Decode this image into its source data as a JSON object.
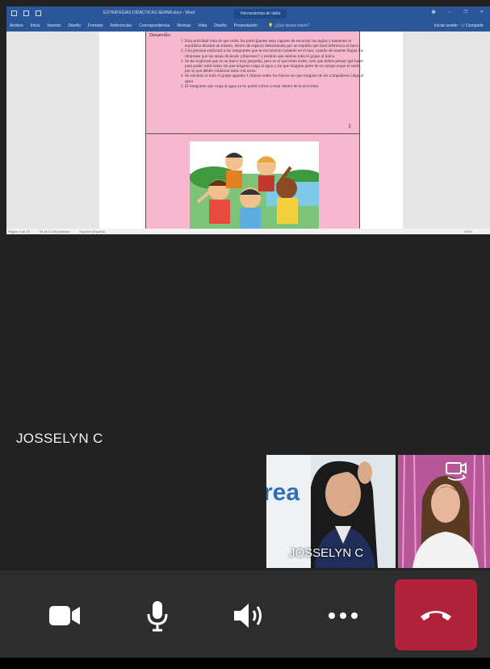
{
  "word": {
    "title": "ESTRATEGIAS DIDÁCTICAS SERNA.docx - Word",
    "context_tab": "Herramientas de tabla",
    "ribbon_tabs": [
      "Archivo",
      "Inicio",
      "Insertar",
      "Diseño",
      "Formato",
      "Referencias",
      "Correspondencia",
      "Revisar",
      "Vista",
      "Diseño",
      "Presentación"
    ],
    "tell_me": "¿Qué desea hacer?",
    "user": "Iniciar sesión",
    "share": "Compartir",
    "section_label": "Desarrollo:",
    "steps": [
      "Esta actividad trata de que todos los participantes sean capaces de escuchar las reglas y mantener el equilibrio durante un mismo, dentro de espacio determinado por un tequillo que hará referencia al barco.",
      "Una persona explicará a los integrantes que se encuentran nadando en el mar, cuando de repente llegan los tiburones que los aman diciendo ¡tiburones!! y tendrán que subirse todo el grupo al barco.",
      "Se les explicará que es un barco muy pequeño, pero es el que están todos, solo que deben pensar qué hacer para poder subir todos sin que ninguno caiga al agua y sin que ninguno parte de su cuerpo toque el suelo, por lo que deben colaborar unos con otros.",
      "Se salvarán si todo el grupo aguanta 1 minuto sobre los barcos sin que ninguno de los compañeros caiga al agua.",
      "El integrante que caiga al agua ya no podrá volver a estar dentro de la actividad."
    ],
    "status_page": "Página 4 de 10",
    "status_words": "93 de 2.446 palabras",
    "status_lang": "Español (España)",
    "status_zoom": "100%"
  },
  "call": {
    "main_participant": "JOSSELYN C",
    "tile_participant": "JOSSELYN C",
    "tile_logo_text": "rea"
  },
  "controls": {
    "video_icon": "video-camera-icon",
    "mic_icon": "microphone-icon",
    "speaker_icon": "speaker-icon",
    "more_icon": "more-options-icon",
    "hangup_icon": "phone-hangup-icon",
    "hangup_color": "#b0233a",
    "switch_icon": "camera-switch-icon"
  }
}
